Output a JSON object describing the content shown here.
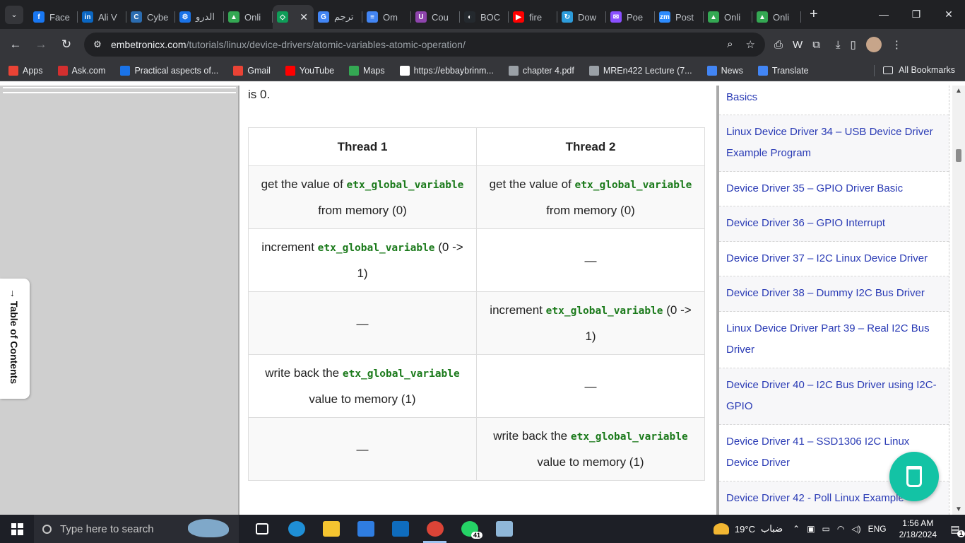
{
  "browser": {
    "tabs": [
      {
        "title": "Face",
        "color": "#1877f2",
        "glyph": "f"
      },
      {
        "title": "Ali V",
        "color": "#0a66c2",
        "glyph": "in"
      },
      {
        "title": "Cybe",
        "color": "#2b6cb0",
        "glyph": "C"
      },
      {
        "title": "الدرو",
        "color": "#1a73e8",
        "glyph": "⚙"
      },
      {
        "title": "Onli",
        "color": "#34a853",
        "glyph": "▲"
      },
      {
        "title": "",
        "color": "#0f9d58",
        "glyph": "◇",
        "active": true
      },
      {
        "title": "ترجم",
        "color": "#4285f4",
        "glyph": "G"
      },
      {
        "title": "Om",
        "color": "#4285f4",
        "glyph": "≡"
      },
      {
        "title": "Cou",
        "color": "#8e44ad",
        "glyph": "U"
      },
      {
        "title": "BOC",
        "color": "#24292e",
        "glyph": "◐"
      },
      {
        "title": "fire",
        "color": "#ff0000",
        "glyph": "▶"
      },
      {
        "title": "Dow",
        "color": "#2d9cdb",
        "glyph": "↻"
      },
      {
        "title": "Poe",
        "color": "#8a4fff",
        "glyph": "✉"
      },
      {
        "title": "Post",
        "color": "#2d8cff",
        "glyph": "zm"
      },
      {
        "title": "Onli",
        "color": "#34a853",
        "glyph": "▲"
      },
      {
        "title": "Onli",
        "color": "#34a853",
        "glyph": "▲"
      }
    ],
    "close_glyph": "✕",
    "new_tab": "+",
    "url_domain": "embetronicx.com",
    "url_path": "/tutorials/linux/device-drivers/atomic-variables-atomic-operation/",
    "bookmarks": [
      {
        "label": "Apps",
        "color": "#ea4335"
      },
      {
        "label": "Ask.com",
        "color": "#d32f2f"
      },
      {
        "label": "Practical aspects of...",
        "color": "#1a73e8"
      },
      {
        "label": "Gmail",
        "color": "#ea4335"
      },
      {
        "label": "YouTube",
        "color": "#ff0000"
      },
      {
        "label": "Maps",
        "color": "#34a853"
      },
      {
        "label": "https://ebbaybrinm...",
        "color": "#ffffff"
      },
      {
        "label": "chapter 4.pdf",
        "color": "#9aa0a6"
      },
      {
        "label": "MREn422 Lecture (7...",
        "color": "#9aa0a6"
      },
      {
        "label": "News",
        "color": "#4285f4"
      },
      {
        "label": "Translate",
        "color": "#4285f4"
      }
    ],
    "all_bookmarks": "All Bookmarks"
  },
  "page": {
    "intro_text": "is 0.",
    "toc_label": "Table of Contents",
    "toc_arrow": "→",
    "table": {
      "headers": [
        "Thread 1",
        "Thread 2"
      ],
      "var": "etx_global_variable",
      "dash": "—",
      "rows": [
        {
          "t1": {
            "pre": "get the value of ",
            "post": " from memory (0)"
          },
          "t2": {
            "pre": "get the value of ",
            "post": " from memory (0)"
          }
        },
        {
          "t1": {
            "pre": "increment ",
            "post": " (0 -> 1)"
          },
          "t2": null
        },
        {
          "t1": null,
          "t2": {
            "pre": "increment ",
            "post": " (0 -> 1)"
          }
        },
        {
          "t1": {
            "pre": "write back the ",
            "post": " value to memory (1)"
          },
          "t2": null
        },
        {
          "t1": null,
          "t2": {
            "pre": "write back the ",
            "post": " value to memory (1)"
          }
        }
      ]
    },
    "sidebar_links": [
      "Basics",
      "Linux Device Driver 34 – USB Device Driver Example Program",
      "Device Driver 35 – GPIO Driver Basic",
      "Device Driver 36 – GPIO Interrupt",
      "Device Driver 37 – I2C Linux Device Driver",
      "Device Driver 38 – Dummy I2C Bus Driver",
      "Linux Device Driver Part 39 – Real I2C Bus Driver",
      "Device Driver 40 – I2C Bus Driver using I2C-GPIO",
      "Device Driver 41 – SSD1306 I2C Linux Device Driver",
      "Device Driver 42 - Poll Linux Example"
    ]
  },
  "taskbar": {
    "search_placeholder": "Type here to search",
    "apps": [
      {
        "name": "task-view",
        "color": "#ffffff"
      },
      {
        "name": "edge",
        "color": "#1f8fd6"
      },
      {
        "name": "file-explorer",
        "color": "#f4c430"
      },
      {
        "name": "store",
        "color": "#2f7de1"
      },
      {
        "name": "mail",
        "color": "#0f6cbd"
      },
      {
        "name": "chrome",
        "color": "#db4437",
        "active": true
      },
      {
        "name": "whatsapp",
        "color": "#25d366",
        "badge": "41"
      },
      {
        "name": "notepad",
        "color": "#8fb7d8"
      }
    ],
    "weather_temp": "19°C",
    "weather_desc": "ضباب",
    "lang": "ENG",
    "time": "1:56 AM",
    "date": "2/18/2024",
    "notifications": "1"
  }
}
